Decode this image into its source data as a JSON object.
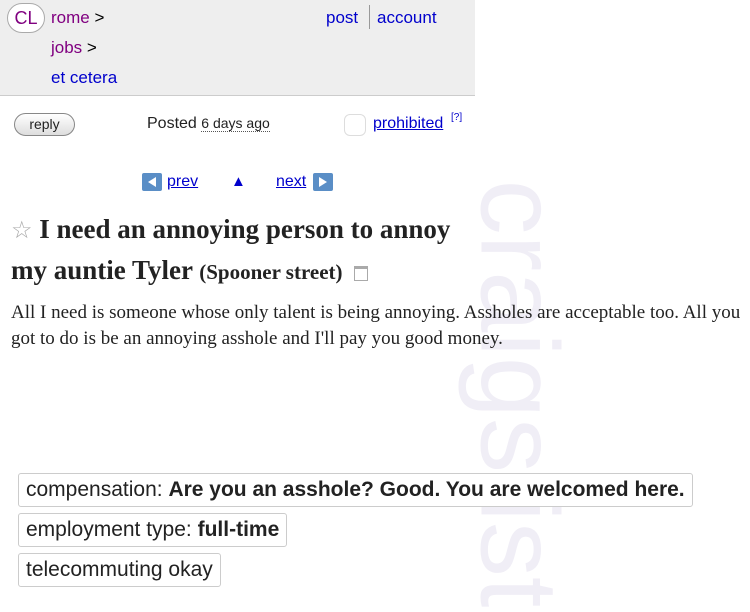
{
  "header": {
    "logo": "CL",
    "breadcrumbs": [
      "rome",
      "jobs",
      "et cetera"
    ],
    "separator": ">",
    "post_label": "post",
    "account_label": "account"
  },
  "posting_bar": {
    "reply_label": "reply",
    "posted_label": "Posted",
    "posted_date": "6 days ago",
    "prohibited_label": "prohibited",
    "help_mark": "[?]"
  },
  "nav": {
    "prev_label": "prev",
    "up_symbol": "▲",
    "next_label": "next"
  },
  "listing": {
    "title": "I need an annoying person to annoy my auntie Tyler",
    "location": "(Spooner street)",
    "body": "All I need is someone whose only talent is being annoying. Assholes are acceptable too. All you got to do is be an annoying asshole and I'll pay you good money."
  },
  "watermark": "craigslist",
  "attributes": {
    "compensation_label": "compensation:",
    "compensation_value": "Are you an asshole? Good. You are welcomed here.",
    "employment_label": "employment type:",
    "employment_value": "full-time",
    "telecommuting": "telecommuting okay"
  }
}
